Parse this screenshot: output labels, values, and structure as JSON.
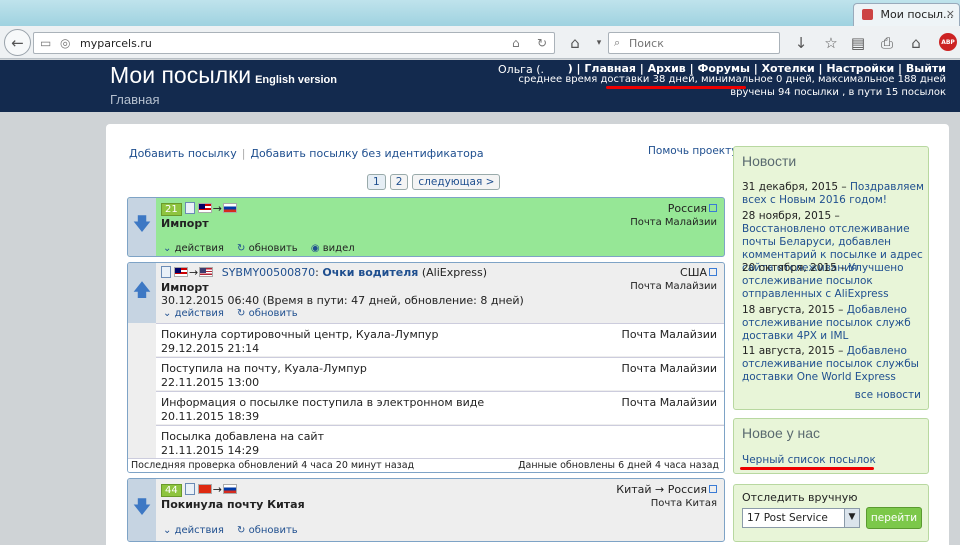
{
  "browser": {
    "tab_title": "Мои посыл...",
    "tab_close": "×",
    "url": "myparcels.ru",
    "search_placeholder": "Поиск",
    "abp_label": "ABP"
  },
  "header": {
    "logo": "Мои посылки",
    "english": "English version",
    "subtitle": "Главная",
    "user": "Ольга (.",
    "menu_text": ") | Главная | Архив | Форумы | Хотелки | Настройки | Выйти",
    "stats_line1_part1": "среднее время доставки 38 дней",
    "stats_line1_part2": ", минимальное 0 дней, максимальное 188 дней",
    "stats_line2": "вручены 94 посылки , в пути 15 посылок"
  },
  "main": {
    "add_parcel": "Добавить посылку",
    "add_parcel_noid": "Добавить посылку без идентификатора",
    "help": "Помочь проекту",
    "pager": [
      "1",
      "2",
      "следующая >"
    ]
  },
  "parcels": [
    {
      "badge": "21",
      "title": "Импорт",
      "dest": "Россия",
      "dest_service": "Почта Малайзии",
      "actions": [
        "действия",
        "обновить",
        "видел"
      ]
    },
    {
      "track": "SYBMY00500870",
      "name": "Очки водителя",
      "shop": " (AliExpress)",
      "title": "Импорт",
      "info": "30.12.2015 06:40 (Время в пути: 47 дней, обновление: 8 дней)",
      "dest": "США",
      "dest_service": "Почта Малайзии",
      "actions": [
        "действия",
        "обновить"
      ],
      "events": [
        {
          "text": "Покинула сортировочный центр, Куала-Лумпур",
          "date": "29.12.2015 21:14",
          "service": "Почта Малайзии"
        },
        {
          "text": "Поступила на почту, Куала-Лумпур",
          "date": "22.11.2015 13:00",
          "service": "Почта Малайзии"
        },
        {
          "text": "Информация о посылке поступила в электронном виде",
          "date": "20.11.2015 18:39",
          "service": "Почта Малайзии"
        },
        {
          "text": "Посылка добавлена на сайт",
          "date": "21.11.2015 14:29",
          "service": ""
        }
      ],
      "last_check": "Последняя проверка обновлений 4 часа 20 минут назад",
      "updated": "Данные обновлены 6 дней 4 часа назад"
    },
    {
      "badge": "44",
      "title": "Покинула почту Китая",
      "dest": "Китай → Россия",
      "dest_service": "Почта Китая",
      "actions": [
        "действия",
        "обновить"
      ]
    }
  ],
  "sidebar": {
    "news_title": "Новости",
    "news": [
      {
        "date": "31 декабря, 2015",
        "text": "Поздравляем всех с Новым 2016 годом!"
      },
      {
        "date": "28 ноября, 2015",
        "text": "Восстановлено отслеживание почты Беларуси, добавлен комментарий к посылке и адрес сайта отслеживания"
      },
      {
        "date": "20 октября, 2015",
        "text": "Улучшено отслеживание посылок отправленных с AliExpress"
      },
      {
        "date": "18 августа, 2015",
        "text": "Добавлено отслеживание посылок служб доставки 4PX и IML"
      },
      {
        "date": "11 августа, 2015",
        "text": "Добавлено отслеживание посылок службы доставки One World Express"
      }
    ],
    "all_news": "все новости",
    "new_title": "Новое у нас",
    "new_link": "Черный список посылок",
    "track_title": "Отследить вручную",
    "track_select": "17 Post Service",
    "track_go": "перейти"
  },
  "colors": {
    "accent_red": "#e00000",
    "header_bg": "#132a4e",
    "green_card": "#96e796"
  }
}
